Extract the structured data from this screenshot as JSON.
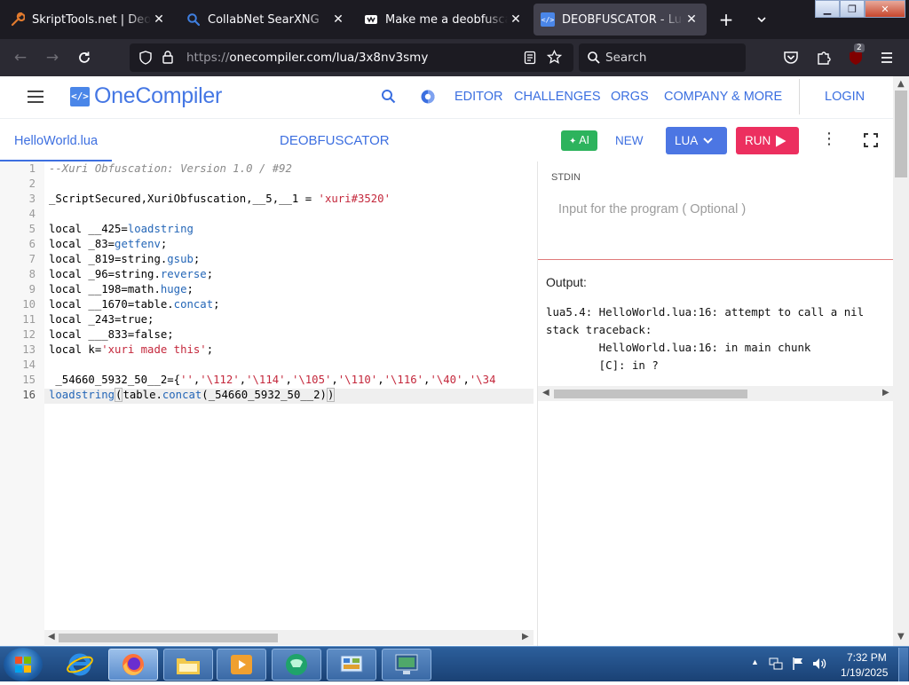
{
  "browser": {
    "tabs": [
      {
        "title": "SkriptTools.net | Deobfusca",
        "icon": "wrench-icon",
        "active": false
      },
      {
        "title": "CollabNet SearXNG",
        "icon": "search-icon",
        "active": false
      },
      {
        "title": "Make me a deobfuscator o",
        "icon": "tab-logo-icon",
        "active": false
      },
      {
        "title": "DEOBFUSCATOR - Lua - Or",
        "icon": "code-brackets-icon",
        "active": true
      }
    ],
    "url_scheme": "https://",
    "url_rest": "onecompiler.com/lua/3x8nv3smy",
    "search_placeholder": "Search",
    "extensions_badge": "2"
  },
  "site": {
    "logo": "OneCompiler",
    "nav": [
      "EDITOR",
      "CHALLENGES",
      "ORGS",
      "COMPANY & MORE"
    ],
    "login": "LOGIN"
  },
  "toolbar": {
    "file_tab": "HelloWorld.lua",
    "project_title": "DEOBFUSCATOR",
    "ai_label": "AI",
    "new_label": "NEW",
    "language_label": "LUA",
    "run_label": "RUN"
  },
  "editor": {
    "line_numbers": [
      "1",
      "2",
      "3",
      "4",
      "5",
      "6",
      "7",
      "8",
      "9",
      "10",
      "11",
      "12",
      "13",
      "14",
      "15",
      "16"
    ],
    "lines": {
      "l1": "--Xuri Obfuscation: Version 1.0 / #92",
      "l3a": "_ScriptSecured,XuriObfuscation,__5,__1 = ",
      "l3b": "'xuri#3520'",
      "l5a": "local __425=",
      "l5b": "loadstring",
      "l6a": "local _83=",
      "l6b": "getfenv",
      "l6c": ";",
      "l7a": "local _819=string.",
      "l7b": "gsub",
      "l7c": ";",
      "l8a": "local _96=string.",
      "l8b": "reverse",
      "l8c": ";",
      "l9a": "local __198=math.",
      "l9b": "huge",
      "l9c": ";",
      "l10a": "local __1670=table.",
      "l10b": "concat",
      "l10c": ";",
      "l11": "local _243=true;",
      "l12": "local ___833=false;",
      "l13a": "local k=",
      "l13b": "'xuri made this'",
      "l13c": ";",
      "l15a": " _54660_5932_50__2={",
      "l15b": "''",
      "l15c": ",",
      "l15d": "'\\112'",
      "l15e": ",",
      "l15f": "'\\114'",
      "l15g": ",",
      "l15h": "'\\105'",
      "l15i": ",",
      "l15j": "'\\110'",
      "l15k": ",",
      "l15l": "'\\116'",
      "l15m": ",",
      "l15n": "'\\40'",
      "l15o": ",",
      "l15p": "'\\34",
      "l16a": "loadstring",
      "l16b": "(",
      "l16c": "table.",
      "l16d": "concat",
      "l16e": "(_54660_5932_50__2)",
      "l16f": ")"
    }
  },
  "stdin": {
    "label": "STDIN",
    "placeholder": "Input for the program ( Optional )"
  },
  "output": {
    "label": "Output:",
    "lines": [
      "lua5.4: HelloWorld.lua:16: attempt to call a nil",
      "stack traceback:",
      "        HelloWorld.lua:16: in main chunk",
      "        [C]: in ?"
    ]
  },
  "taskbar": {
    "time": "7:32 PM",
    "date": "1/19/2025"
  },
  "colors": {
    "accent": "#3d6fe0",
    "run": "#ec2f5f",
    "ai": "#2db35d",
    "string": "#c4283c",
    "function": "#2466b7"
  }
}
